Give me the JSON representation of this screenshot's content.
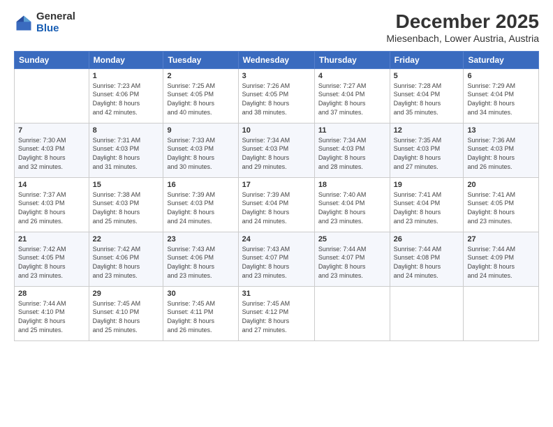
{
  "logo": {
    "general": "General",
    "blue": "Blue"
  },
  "title": "December 2025",
  "subtitle": "Miesenbach, Lower Austria, Austria",
  "days_header": [
    "Sunday",
    "Monday",
    "Tuesday",
    "Wednesday",
    "Thursday",
    "Friday",
    "Saturday"
  ],
  "weeks": [
    [
      {
        "num": "",
        "info": ""
      },
      {
        "num": "1",
        "info": "Sunrise: 7:23 AM\nSunset: 4:06 PM\nDaylight: 8 hours\nand 42 minutes."
      },
      {
        "num": "2",
        "info": "Sunrise: 7:25 AM\nSunset: 4:05 PM\nDaylight: 8 hours\nand 40 minutes."
      },
      {
        "num": "3",
        "info": "Sunrise: 7:26 AM\nSunset: 4:05 PM\nDaylight: 8 hours\nand 38 minutes."
      },
      {
        "num": "4",
        "info": "Sunrise: 7:27 AM\nSunset: 4:04 PM\nDaylight: 8 hours\nand 37 minutes."
      },
      {
        "num": "5",
        "info": "Sunrise: 7:28 AM\nSunset: 4:04 PM\nDaylight: 8 hours\nand 35 minutes."
      },
      {
        "num": "6",
        "info": "Sunrise: 7:29 AM\nSunset: 4:04 PM\nDaylight: 8 hours\nand 34 minutes."
      }
    ],
    [
      {
        "num": "7",
        "info": "Sunrise: 7:30 AM\nSunset: 4:03 PM\nDaylight: 8 hours\nand 32 minutes."
      },
      {
        "num": "8",
        "info": "Sunrise: 7:31 AM\nSunset: 4:03 PM\nDaylight: 8 hours\nand 31 minutes."
      },
      {
        "num": "9",
        "info": "Sunrise: 7:33 AM\nSunset: 4:03 PM\nDaylight: 8 hours\nand 30 minutes."
      },
      {
        "num": "10",
        "info": "Sunrise: 7:34 AM\nSunset: 4:03 PM\nDaylight: 8 hours\nand 29 minutes."
      },
      {
        "num": "11",
        "info": "Sunrise: 7:34 AM\nSunset: 4:03 PM\nDaylight: 8 hours\nand 28 minutes."
      },
      {
        "num": "12",
        "info": "Sunrise: 7:35 AM\nSunset: 4:03 PM\nDaylight: 8 hours\nand 27 minutes."
      },
      {
        "num": "13",
        "info": "Sunrise: 7:36 AM\nSunset: 4:03 PM\nDaylight: 8 hours\nand 26 minutes."
      }
    ],
    [
      {
        "num": "14",
        "info": "Sunrise: 7:37 AM\nSunset: 4:03 PM\nDaylight: 8 hours\nand 26 minutes."
      },
      {
        "num": "15",
        "info": "Sunrise: 7:38 AM\nSunset: 4:03 PM\nDaylight: 8 hours\nand 25 minutes."
      },
      {
        "num": "16",
        "info": "Sunrise: 7:39 AM\nSunset: 4:03 PM\nDaylight: 8 hours\nand 24 minutes."
      },
      {
        "num": "17",
        "info": "Sunrise: 7:39 AM\nSunset: 4:04 PM\nDaylight: 8 hours\nand 24 minutes."
      },
      {
        "num": "18",
        "info": "Sunrise: 7:40 AM\nSunset: 4:04 PM\nDaylight: 8 hours\nand 23 minutes."
      },
      {
        "num": "19",
        "info": "Sunrise: 7:41 AM\nSunset: 4:04 PM\nDaylight: 8 hours\nand 23 minutes."
      },
      {
        "num": "20",
        "info": "Sunrise: 7:41 AM\nSunset: 4:05 PM\nDaylight: 8 hours\nand 23 minutes."
      }
    ],
    [
      {
        "num": "21",
        "info": "Sunrise: 7:42 AM\nSunset: 4:05 PM\nDaylight: 8 hours\nand 23 minutes."
      },
      {
        "num": "22",
        "info": "Sunrise: 7:42 AM\nSunset: 4:06 PM\nDaylight: 8 hours\nand 23 minutes."
      },
      {
        "num": "23",
        "info": "Sunrise: 7:43 AM\nSunset: 4:06 PM\nDaylight: 8 hours\nand 23 minutes."
      },
      {
        "num": "24",
        "info": "Sunrise: 7:43 AM\nSunset: 4:07 PM\nDaylight: 8 hours\nand 23 minutes."
      },
      {
        "num": "25",
        "info": "Sunrise: 7:44 AM\nSunset: 4:07 PM\nDaylight: 8 hours\nand 23 minutes."
      },
      {
        "num": "26",
        "info": "Sunrise: 7:44 AM\nSunset: 4:08 PM\nDaylight: 8 hours\nand 24 minutes."
      },
      {
        "num": "27",
        "info": "Sunrise: 7:44 AM\nSunset: 4:09 PM\nDaylight: 8 hours\nand 24 minutes."
      }
    ],
    [
      {
        "num": "28",
        "info": "Sunrise: 7:44 AM\nSunset: 4:10 PM\nDaylight: 8 hours\nand 25 minutes."
      },
      {
        "num": "29",
        "info": "Sunrise: 7:45 AM\nSunset: 4:10 PM\nDaylight: 8 hours\nand 25 minutes."
      },
      {
        "num": "30",
        "info": "Sunrise: 7:45 AM\nSunset: 4:11 PM\nDaylight: 8 hours\nand 26 minutes."
      },
      {
        "num": "31",
        "info": "Sunrise: 7:45 AM\nSunset: 4:12 PM\nDaylight: 8 hours\nand 27 minutes."
      },
      {
        "num": "",
        "info": ""
      },
      {
        "num": "",
        "info": ""
      },
      {
        "num": "",
        "info": ""
      }
    ]
  ]
}
